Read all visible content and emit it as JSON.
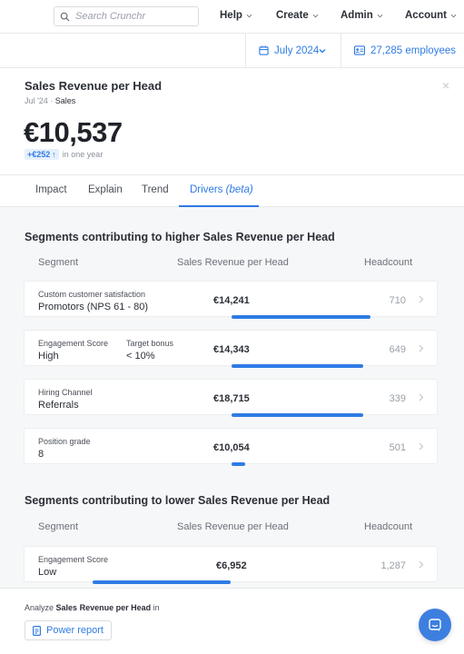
{
  "nav": {
    "search_placeholder": "Search Crunchr",
    "menus": [
      "Help",
      "Create",
      "Admin",
      "Account"
    ]
  },
  "filters": {
    "date": "July 2024",
    "employees": "27,285 employees"
  },
  "metric": {
    "title": "Sales Revenue per Head",
    "period": "Jul '24",
    "separator": " · ",
    "segment": "Sales",
    "value": "€10,537",
    "delta": "+€252",
    "delta_suffix": "in one year",
    "close": "×"
  },
  "tabs": [
    {
      "label": "Impact"
    },
    {
      "label": "Explain"
    },
    {
      "label": "Trend"
    },
    {
      "label": "Drivers",
      "suffix": "(beta)"
    }
  ],
  "higher": {
    "title": "Segments contributing to higher Sales Revenue per Head",
    "col_segment": "Segment",
    "col_metric": "Sales Revenue per Head",
    "col_headcount": "Headcount",
    "rows": [
      {
        "label1": "Custom customer satisfaction",
        "value1": "Promotors (NPS 61 - 80)",
        "label2": "",
        "value2": "",
        "metric": "€14,241",
        "headcount": "710"
      },
      {
        "label1": "Engagement Score",
        "value1": "High",
        "label2": "Target bonus",
        "value2": "< 10%",
        "metric": "€14,343",
        "headcount": "649"
      },
      {
        "label1": "Hiring Channel",
        "value1": "Referrals",
        "label2": "",
        "value2": "",
        "metric": "€18,715",
        "headcount": "339"
      },
      {
        "label1": "Position grade",
        "value1": "8",
        "label2": "",
        "value2": "",
        "metric": "€10,054",
        "headcount": "501"
      }
    ]
  },
  "lower": {
    "title": "Segments contributing to lower Sales Revenue per Head",
    "col_segment": "Segment",
    "col_metric": "Sales Revenue per Head",
    "col_headcount": "Headcount",
    "rows": [
      {
        "label1": "Engagement Score",
        "value1": "Low",
        "metric": "€6,952",
        "headcount": "1,287"
      }
    ]
  },
  "footer": {
    "prefix": "Analyze",
    "metric": "Sales Revenue per Head",
    "suffix": "in",
    "button": "Power report"
  },
  "colors": {
    "accent": "#2f7be5",
    "chat": "#3d7fe0"
  }
}
